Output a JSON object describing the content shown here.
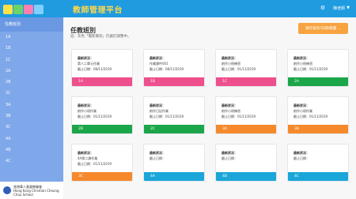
{
  "header": {
    "app_title": "教師管理平台",
    "user_name": "陳老師",
    "colors": {
      "bar": "#1f9be0",
      "title": "#ffd84a"
    }
  },
  "sidebar": {
    "title": "任教班別",
    "items": [
      "1A",
      "1B",
      "1C",
      "2A",
      "2B",
      "2C",
      "3A",
      "3B",
      "3C",
      "4A",
      "4B",
      "4C"
    ],
    "school_name_line1": "香港華人基督教聯會",
    "school_name_line2": "Hong Kong Christian Cheung Chau School"
  },
  "main": {
    "title": "任教班別",
    "subtitle": "註：灰色「電影資訊」仍處於調整中。",
    "switch_button": "顯示班別/日期/範圍 ⌄",
    "status_label": "最新狀況：",
    "cards": [
      {
        "status": "第八二單元作業",
        "date": "截止日期：08/11/2019",
        "class": "1A",
        "color": "#ee4f8d"
      },
      {
        "status": "作業課件001",
        "date": "截止日期：08/11/2019",
        "class": "1B",
        "color": "#ee4f8d"
      },
      {
        "status": "創作小冊練習",
        "date": "截止日期：01/11/2019",
        "class": "1C",
        "color": "#ee4f8d"
      },
      {
        "status": "創作小冊練習",
        "date": "截止日期：01/11/2019",
        "class": "2A",
        "color": "#1ca64a"
      },
      {
        "status": "創作小冊作業",
        "date": "截止日期：01/11/2019",
        "class": "2B",
        "color": "#1ca64a"
      },
      {
        "status": "創作日記作業",
        "date": "截止日期：01/11/2019",
        "class": "2C",
        "color": "#1ca64a"
      },
      {
        "status": "創作小冊練習",
        "date": "截止日期：01/11/2019",
        "class": "3A",
        "color": "#f5892c"
      },
      {
        "status": "創作小冊作業",
        "date": "截止日期：01/11/2019",
        "class": "3B",
        "color": "#f5892c"
      },
      {
        "status": "4A第二課作業",
        "date": "截止日期：01/11/2019",
        "class": "3C",
        "color": "#f5892c"
      },
      {
        "status": "",
        "date": "截止日期：",
        "class": "4A",
        "color": "#1aa6d8"
      },
      {
        "status": "",
        "date": "截止日期：",
        "class": "4B",
        "color": "#1aa6d8"
      },
      {
        "status": "",
        "date": "截止日期：",
        "class": "4C",
        "color": "#1aa6d8"
      }
    ]
  }
}
